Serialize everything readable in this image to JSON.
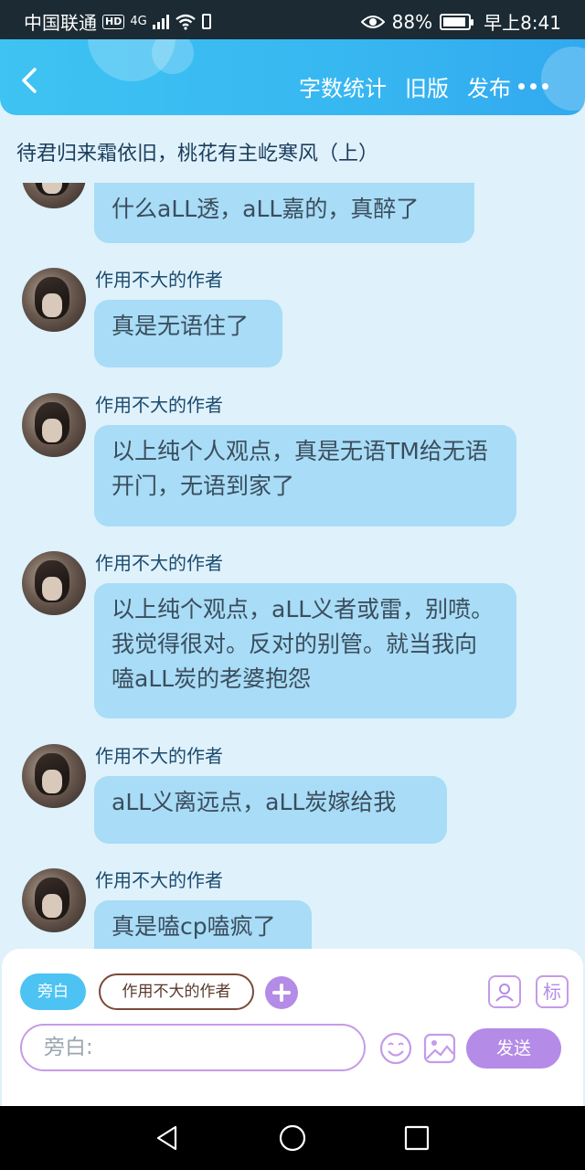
{
  "status_bar": {
    "carrier": "中国联通",
    "hd": "HD",
    "network": "4G",
    "battery": "88%",
    "time": "早上8:41"
  },
  "header": {
    "word_count": "字数统计",
    "old_version": "旧版",
    "publish": "发布"
  },
  "doc_title": "待君归来霜依旧，桃花有主屹寒风（上）",
  "messages": [
    {
      "text": "什么aLL透，aLL嘉的，真醉了"
    },
    {
      "sender": "作用不大的作者",
      "text": "真是无语住了"
    },
    {
      "sender": "作用不大的作者",
      "text": "以上纯个人观点，真是无语TM给无语开门，无语到家了"
    },
    {
      "sender": "作用不大的作者",
      "text": "以上纯个观点，aLL义者或雷，别喷。我觉得很对。反对的别管。就当我向嗑aLL炭的老婆抱怨"
    },
    {
      "sender": "作用不大的作者",
      "text": "aLL义离远点，aLL炭嫁给我"
    },
    {
      "sender": "作用不大的作者",
      "text": "真是嗑cp嗑疯了"
    }
  ],
  "input_panel": {
    "aside_chip": "旁白",
    "role_chip": "作用不大的作者",
    "mark_label": "标",
    "placeholder": "旁白:",
    "send": "发送"
  }
}
